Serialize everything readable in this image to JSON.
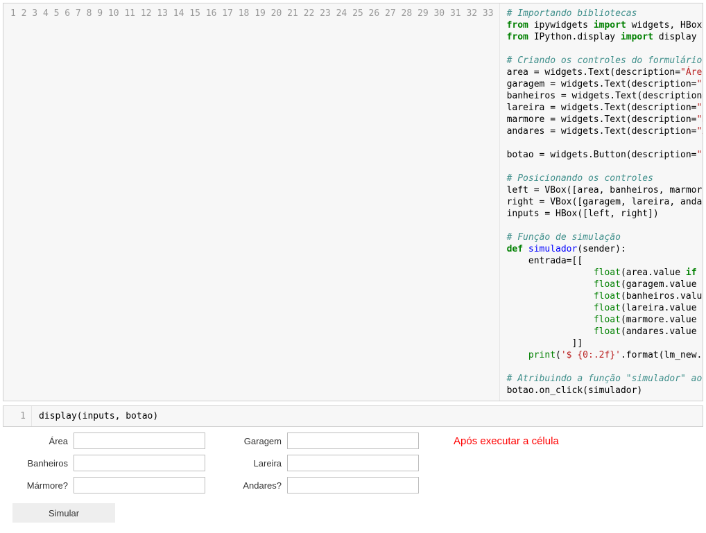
{
  "cell1": {
    "line_count": 33,
    "code_html": "<span class=\"c\"># Importando bibliotecas</span>\n<span class=\"kw\">from</span> ipywidgets <span class=\"kw\">import</span> widgets, HBox, VBox\n<span class=\"kw\">from</span> IPython.display <span class=\"kw\">import</span> display\n\n<span class=\"c\"># Criando os controles do formul&aacute;rio</span>\narea = widgets.Text(description=<span class=\"st\">\"&Aacute;rea\"</span>)\ngaragem = widgets.Text(description=<span class=\"st\">\"Garagem\"</span>)\nbanheiros = widgets.Text(description=<span class=\"st\">\"Banheiros\"</span>)\nlareira = widgets.Text(description=<span class=\"st\">\"Lareira\"</span>)\nmarmore = widgets.Text(description=<span class=\"st\">\"M&aacute;rmore?\"</span>)\nandares = widgets.Text(description=<span class=\"st\">\"Andares?\"</span>)\n\nbotao = widgets.Button(description=<span class=\"st\">\"Simular\"</span>)\n\n<span class=\"c\"># Posicionando os controles</span>\nleft = VBox([area, banheiros, marmore])\nright = VBox([garagem, lareira, andares])\ninputs = HBox([left, right])\n\n<span class=\"c\"># Fun&ccedil;&atilde;o de simula&ccedil;&atilde;o</span>\n<span class=\"kw\">def</span> <span class=\"nf\">simulador</span>(sender):\n    entrada=[[\n                <span class=\"nb\">float</span>(area.value <span class=\"kw\">if</span> area.value <span class=\"kw\">else</span> <span class=\"num\">0</span>),\n                <span class=\"nb\">float</span>(garagem.value <span class=\"kw\">if</span> garagem.value <span class=\"kw\">else</span> <span class=\"num\">0</span>),\n                <span class=\"nb\">float</span>(banheiros.value <span class=\"kw\">if</span> banheiros.value <span class=\"kw\">else</span> <span class=\"num\">0</span>),\n                <span class=\"nb\">float</span>(lareira.value <span class=\"kw\">if</span> lareira.value <span class=\"kw\">else</span> <span class=\"num\">0</span>),\n                <span class=\"nb\">float</span>(marmore.value <span class=\"kw\">if</span> marmore.value <span class=\"kw\">else</span> <span class=\"num\">0</span>),\n                <span class=\"nb\">float</span>(andares.value <span class=\"kw\">if</span> andares.value <span class=\"kw\">else</span> <span class=\"num\">0</span>)\n            ]]\n    <span class=\"nb\">print</span>(<span class=\"st\">'$ {0:.2f}'</span>.format(lm_new.predict(entrada)[<span class=\"num\">0</span>]))\n\n<span class=\"c\"># Atribuindo a fun&ccedil;&atilde;o \"simulador\" ao evento click do bot&atilde;o</span>\nbotao.on_click(simulador)"
  },
  "cell2": {
    "line_count": 1,
    "code_html": "display(inputs, botao)"
  },
  "output": {
    "left_labels": [
      "Área",
      "Banheiros",
      "Mármore?"
    ],
    "right_labels": [
      "Garagem",
      "Lareira",
      "Andares?"
    ],
    "button_label": "Simular",
    "annotation": "Após executar a célula"
  }
}
